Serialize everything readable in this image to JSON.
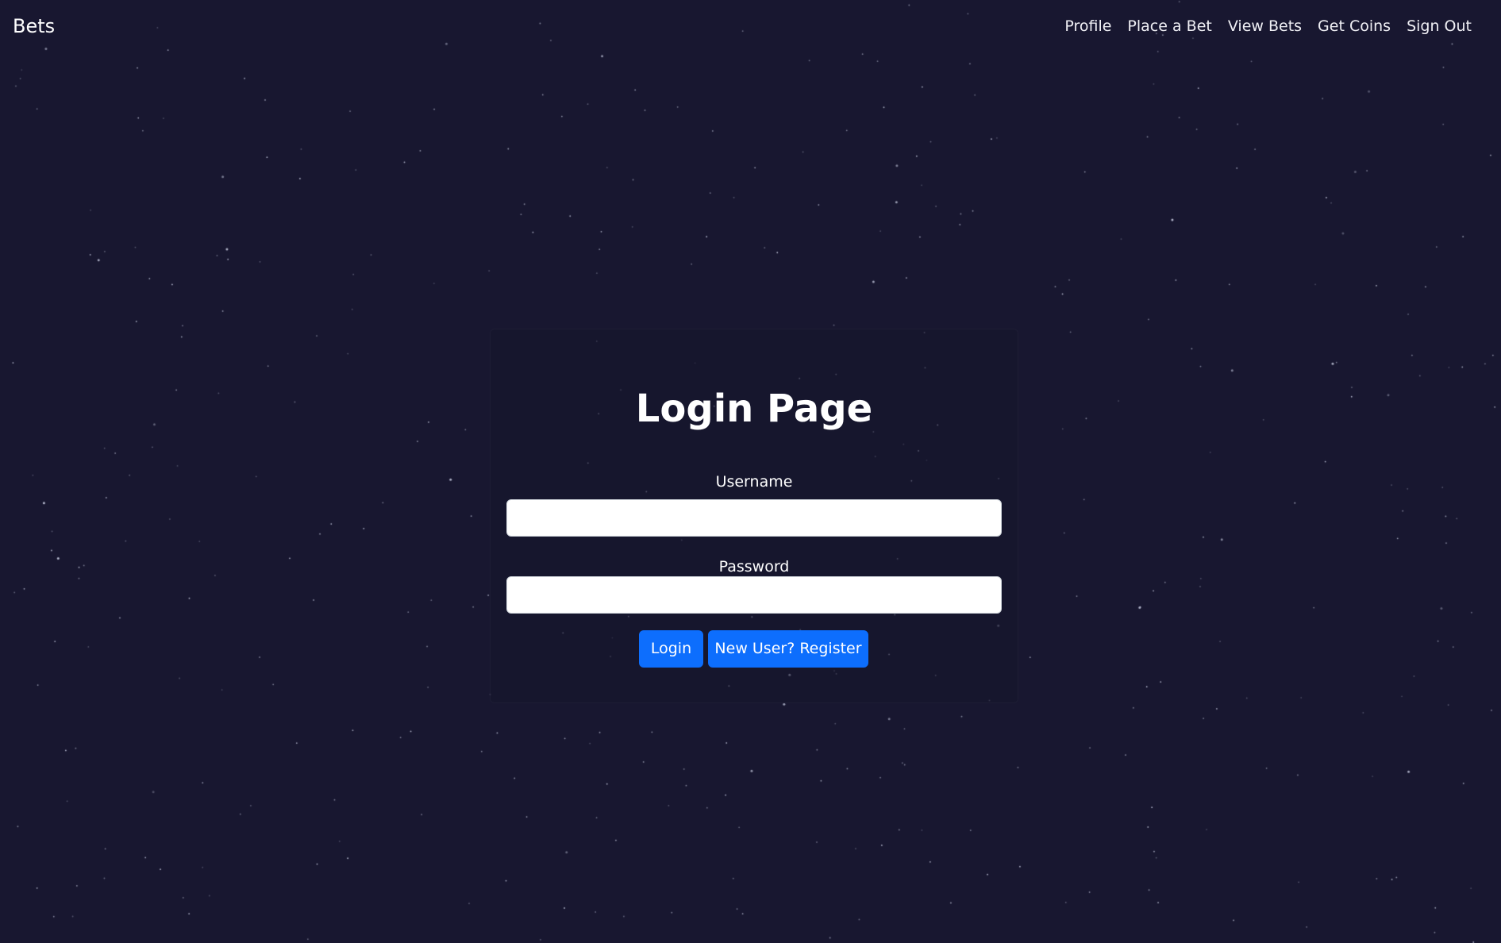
{
  "navbar": {
    "brand": "Bets",
    "links": [
      {
        "label": "Profile"
      },
      {
        "label": "Place a Bet"
      },
      {
        "label": "View Bets"
      },
      {
        "label": "Get Coins"
      },
      {
        "label": "Sign Out"
      }
    ]
  },
  "login": {
    "title": "Login Page",
    "username_label": "Username",
    "username_value": "",
    "password_label": "Password",
    "password_value": "",
    "login_button": "Login",
    "register_button": "New User? Register"
  },
  "colors": {
    "background": "#181730",
    "primary_button": "#0d6efd",
    "text": "#ffffff"
  }
}
